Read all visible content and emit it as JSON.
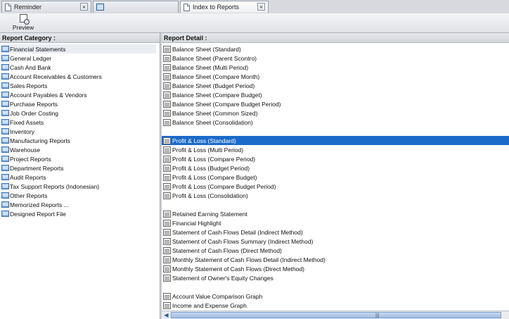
{
  "tabs": [
    {
      "label": "Reminder",
      "active": false,
      "icon": "document-icon"
    },
    {
      "label": "",
      "active": false,
      "icon": "window-icon"
    },
    {
      "label": "Index to Reports",
      "active": true,
      "icon": "document-icon"
    }
  ],
  "toolbar": {
    "preview_label": "Preview"
  },
  "left_header": "Report Category :",
  "right_header": "Report Detail :",
  "categories": [
    "Financial Statements",
    "General Ledger",
    "Cash And Bank",
    "Account Receivables & Customers",
    "Sales Reports",
    "Account Payables & Vendors",
    "Purchase Reports",
    "Job Order Costing",
    "Fixed Assets",
    "Inventory",
    "Manufacturing Reports",
    "Warehouse",
    "Project Reports",
    "Department Reports",
    "Audit Reports",
    "Tax Support Reports (Indonesian)",
    "Other Reports",
    "Memorized Reports ...",
    "Designed Report File"
  ],
  "selected_category": 0,
  "details": [
    "Balance Sheet (Standard)",
    "Balance Sheet (Parent Scontro)",
    "Balance Sheet (Multi Period)",
    "Balance Sheet (Compare Month)",
    "Balance Sheet (Budget Period)",
    "Balance Sheet (Compare Budget)",
    "Balance Sheet (Compare Budget Period)",
    "Balance Sheet (Common Sized)",
    "Balance Sheet (Consolidation)",
    "",
    "Profit & Loss (Standard)",
    "Profit & Loss (Multi Period)",
    "Profit & Loss (Compare Period)",
    "Profit & Loss (Budget Period)",
    "Profit & Loss (Compare Budget)",
    "Profit & Loss (Compare Budget Period)",
    "Profit & Loss (Consolidation)",
    "",
    "Retained Earning Statement",
    "Financial Highlight",
    "Statement of Cash Flows Detail (Indirect Method)",
    "Statement of Cash Flows Summary (Indirect Method)",
    "Statement of Cash Flows (Direct Method)",
    "Monthly Statement of Cash Flows Detail (Indirect Method)",
    "Monthly Statement of Cash Flows (Direct Method)",
    "Statement of Owner's Equity Changes",
    "",
    "Account Value Comparison Graph",
    "Income and Expense Graph"
  ],
  "selected_detail": 10,
  "colors": {
    "selection": "#1b6ac9",
    "category_icon": "#7fa9dc"
  }
}
